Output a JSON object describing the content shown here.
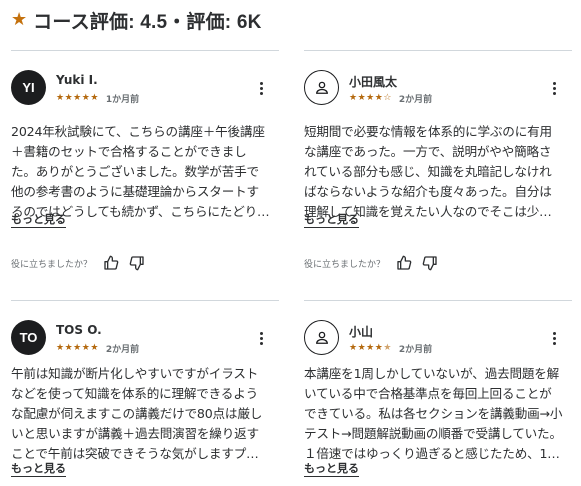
{
  "header": {
    "star_icon": "star-icon",
    "title": "コース評価: 4.5・評価: 6K"
  },
  "reviews": [
    {
      "avatar_text": "YI",
      "name": "Yuki I.",
      "rating": 5,
      "time": "1か月前",
      "body": "2024年秋試験にて、こちらの講座＋午後講座\n＋書籍のセットで合格することができまし\nた。ありがとうございました。数学が苦手で\n他の参考書のように基礎理論からスタートす\nるのではどうしても続かず、こちらにたどり…",
      "more_label": "もっと見る",
      "helpful_label": "役に立ちましたか？"
    },
    {
      "avatar_text": "",
      "avatar_icon": "user-icon",
      "name": "小田風太",
      "rating": 4,
      "time": "2か月前",
      "body": "短期間で必要な情報を体系的に学ぶのに有用\nな講座であった。一方で、説明がやや簡略さ\nれている部分も感じ、知識を丸暗記しなけれ\nばならないような紹介も度々あった。自分は\n理解して知識を覚えたい人なのでそこは少…",
      "more_label": "もっと見る",
      "helpful_label": "役に立ちましたか？"
    },
    {
      "avatar_text": "TO",
      "name": "TOS O.",
      "rating": 5,
      "time": "2か月前",
      "body": "午前は知識が断片化しやすいですがイラスト\nなどを使って知識を体系的に理解できるよう\nな配慮が伺えますこの講義だけで80点は厳し\nいと思いますが講義＋過去問演習を繰り返す\nことで午前は突破できそうな気がしますプ…",
      "more_label": "もっと見る"
    },
    {
      "avatar_text": "",
      "avatar_icon": "user-icon",
      "name": "小山",
      "rating": 4.5,
      "time": "2か月前",
      "body": "本講座を1周しかしていないが、過去問題を解\nいている中で合格基準点を毎回上回ることが\nできている。私は各セクションを講義動画→小\nテスト→問題解説動画の順番で受講していた。\n１倍速ではゆっくり過ぎると感じたため、1…",
      "more_label": "もっと見る"
    }
  ],
  "colors": {
    "star": "#b4690e",
    "text": "#2d2f31",
    "muted": "#6a6f73",
    "divider": "#d1d7dc"
  }
}
